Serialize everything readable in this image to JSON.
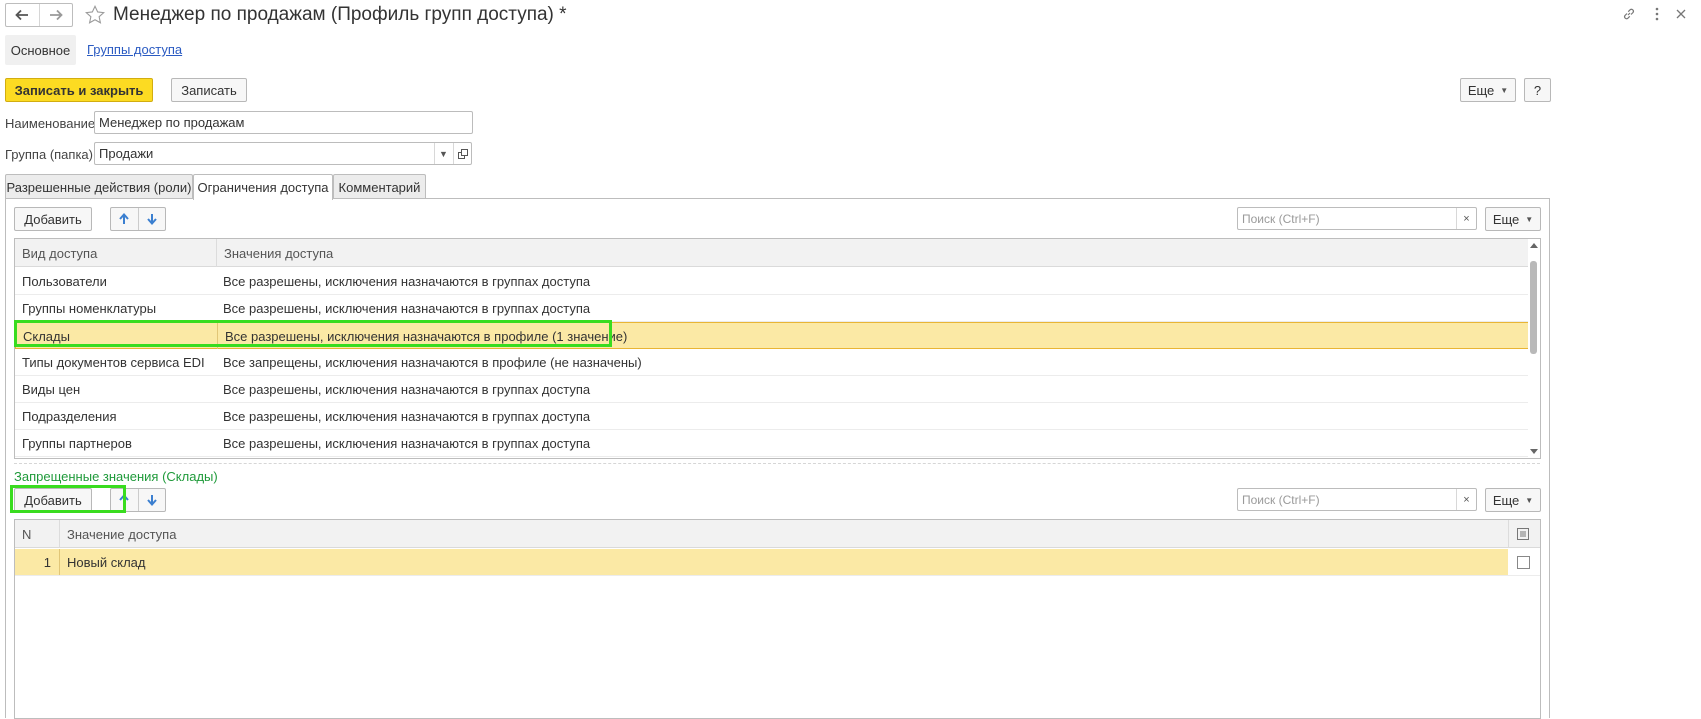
{
  "header": {
    "title": "Менеджер по продажам (Профиль групп доступа) *",
    "back_icon": "arrow-left-icon",
    "forward_icon": "arrow-right-icon",
    "favorite_icon": "star-icon"
  },
  "section_tabs": {
    "main": "Основное",
    "access_groups": "Группы доступа"
  },
  "toolbar": {
    "save_close": "Записать и закрыть",
    "save": "Записать",
    "more": "Еще",
    "help": "?"
  },
  "form": {
    "name_label": "Наименование:",
    "name_value": "Менеджер по продажам",
    "group_label": "Группа (папка):",
    "group_value": "Продажи"
  },
  "tabs": [
    {
      "label": "Разрешенные действия (роли)"
    },
    {
      "label": "Ограничения доступа"
    },
    {
      "label": "Комментарий"
    }
  ],
  "access_panel": {
    "add": "Добавить",
    "search_placeholder": "Поиск (Ctrl+F)",
    "clear": "×",
    "more": "Еще",
    "columns": [
      "Вид доступа",
      "Значения доступа"
    ],
    "rows": [
      {
        "kind": "Пользователи",
        "value": "Все разрешены, исключения назначаются в группах доступа"
      },
      {
        "kind": "Группы номенклатуры",
        "value": "Все разрешены, исключения назначаются в группах доступа"
      },
      {
        "kind": "Склады",
        "value": "Все разрешены, исключения назначаются в профиле (1 значение)"
      },
      {
        "kind": "Типы документов сервиса EDI",
        "value": "Все запрещены, исключения назначаются в профиле (не назначены)"
      },
      {
        "kind": "Виды цен",
        "value": "Все разрешены, исключения назначаются в группах доступа"
      },
      {
        "kind": "Подразделения",
        "value": "Все разрешены, исключения назначаются в группах доступа"
      },
      {
        "kind": "Группы партнеров",
        "value": "Все разрешены, исключения назначаются в группах доступа"
      }
    ],
    "selected_row": 2
  },
  "values_panel": {
    "title": "Запрещенные значения (Склады)",
    "add": "Добавить",
    "search_placeholder": "Поиск (Ctrl+F)",
    "clear": "×",
    "more": "Еще",
    "columns": [
      "N",
      "Значение доступа"
    ],
    "rows": [
      {
        "n": "1",
        "value": "Новый склад"
      }
    ]
  }
}
